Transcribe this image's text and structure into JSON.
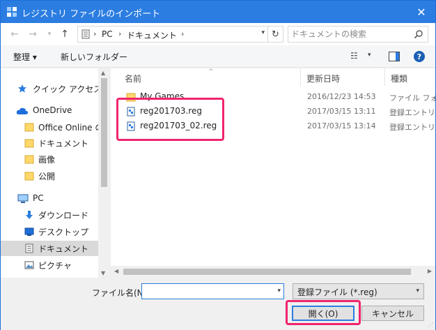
{
  "window": {
    "title": "レジストリ ファイルのインポート",
    "close_glyph": "✕"
  },
  "address": {
    "segments": [
      "PC",
      "ドキュメント"
    ],
    "chevron": "›",
    "dropdown_glyph": "▾",
    "refresh_glyph": "↻"
  },
  "nav": {
    "back_glyph": "←",
    "forward_glyph": "→",
    "recent_glyph": "▾",
    "up_glyph": "↑"
  },
  "search": {
    "placeholder": "ドキュメントの検索"
  },
  "toolbar": {
    "organize_label": "整理 ▾",
    "new_folder_label": "新しいフォルダー",
    "view_glyph": "☷",
    "view_drop_glyph": "▾",
    "help_label": "?"
  },
  "sidebar": {
    "items": [
      {
        "label": "クイック アクセス",
        "icon": "star-icon"
      },
      {
        "label": "OneDrive",
        "icon": "cloud-icon"
      },
      {
        "label": "Office Online の拡",
        "icon": "folder-icon"
      },
      {
        "label": "ドキュメント",
        "icon": "folder-icon"
      },
      {
        "label": "画像",
        "icon": "folder-icon"
      },
      {
        "label": "公開",
        "icon": "folder-icon"
      },
      {
        "label": "PC",
        "icon": "computer-icon"
      },
      {
        "label": "ダウンロード",
        "icon": "download-icon"
      },
      {
        "label": "デスクトップ",
        "icon": "desktop-icon"
      },
      {
        "label": "ドキュメント",
        "icon": "document-icon"
      },
      {
        "label": "ピクチャ",
        "icon": "picture-icon"
      }
    ],
    "scroll_up_glyph": "▲",
    "scroll_down_glyph": "▼"
  },
  "file_list": {
    "columns": [
      "名前",
      "更新日時",
      "種類"
    ],
    "sort_glyph": "^",
    "rows": [
      {
        "name": "My Games",
        "date": "2016/12/23 14:53",
        "type": "ファイル フォルダー",
        "icon": "folder-icon"
      },
      {
        "name": "reg201703.reg",
        "date": "2017/03/15 13:11",
        "type": "登録エントリ",
        "icon": "registry-file-icon"
      },
      {
        "name": "reg201703_02.reg",
        "date": "2017/03/15 13:14",
        "type": "登録エントリ",
        "icon": "registry-file-icon"
      }
    ],
    "scroll_left_glyph": "◀",
    "scroll_right_glyph": "▶"
  },
  "bottom": {
    "filename_label": "ファイル名(N):",
    "filename_value": "",
    "filename_drop_glyph": "▾",
    "filetype_value": "登録ファイル (*.reg)",
    "filetype_drop_glyph": "▾",
    "open_label": "開く(O)",
    "cancel_label": "キャンセル",
    "grip_glyph": "⋰"
  },
  "colors": {
    "titlebar": "#2b7de1",
    "highlight": "#f0246e",
    "selection": "#d9d9d9"
  }
}
